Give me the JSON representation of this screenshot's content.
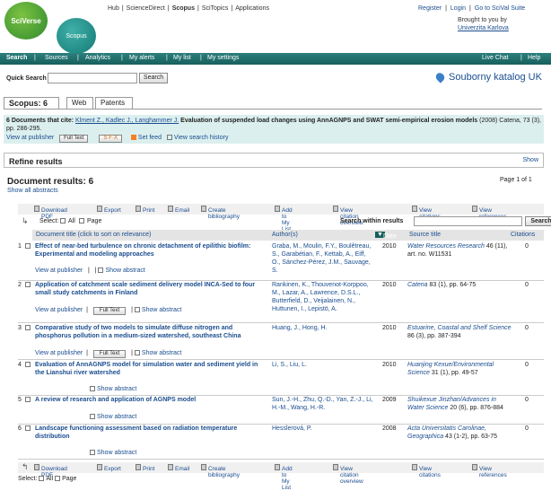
{
  "header": {
    "logo_main": "SciVerse",
    "logo_sub": "Scopus",
    "topnav": [
      "Hub",
      "|",
      "ScienceDirect",
      "|",
      "Scopus",
      "|",
      "SciTopics",
      "|",
      "Applications"
    ],
    "topright": [
      "Register",
      "|",
      "Login",
      "|",
      "Go to SciVal Suite"
    ],
    "brought_line1": "Brought to you by",
    "brought_line2": "Univerzita Karlova"
  },
  "mainbar": {
    "left": [
      "Search",
      "|",
      "Sources",
      "|",
      "Analytics",
      "|",
      "My alerts",
      "|",
      "My list",
      "|",
      "My settings"
    ],
    "live_chat": "Live Chat",
    "sep": "|",
    "help": "Help"
  },
  "quick_search": {
    "label": "Quick Search",
    "value": "",
    "button": "Search",
    "katalog": "Souborny katalog UK"
  },
  "tabs": [
    "Scopus: 6",
    "Web",
    "Patents"
  ],
  "cite": {
    "count_text": "6  Documents that cite:",
    "authors": "Klment Z., Kadlec J., Langhammer J.",
    "title": "Evaluation of suspended load changes using AnnAGNPS and SWAT semi-empirical erosion models",
    "source": "(2008) Catena, 73 (3), pp. 286-295.",
    "view_publisher": "View at publisher",
    "full_text": "Full Text",
    "sfx": "S·F·X",
    "rss": "Set feed",
    "history": "View search history"
  },
  "refine": {
    "title": "Refine results",
    "show": "Show"
  },
  "results": {
    "title": "Document results: 6",
    "show_abstracts": "Show all abstracts",
    "page_label": "Page",
    "page_info": "1 of 1"
  },
  "toolbar": [
    "Download PDF",
    "|",
    "Export",
    "|",
    "Print",
    "|",
    "Email",
    "|",
    "Create bibliography",
    "|",
    "Add to My List",
    "|",
    "View citation overview",
    "|",
    "View citations",
    "|",
    "View references"
  ],
  "select": {
    "label": "Select:",
    "all": "All",
    "page": "Page"
  },
  "search_within": {
    "label": "Search within results",
    "button": "Search",
    "value": ""
  },
  "table_headers": {
    "title": "Document title (click to sort on relevance)",
    "authors": "Author(s)",
    "date": "Date",
    "source": "Source title",
    "citations": "Citations"
  },
  "row_actions": {
    "view_publisher": "View at publisher",
    "full_text": "Full Text",
    "show_abstract": "Show abstract",
    "sep": "|"
  },
  "rows": [
    {
      "n": "1",
      "title": "Effect of near-bed turbulence on chronic detachment of epilithic biofilm: Experimental and modeling approaches",
      "authors": "Graba, M., Moulin, F.Y., Boulêtreau, S., Garabétian, F., Kettab, A., Eiff, O., Sánchez-Pérez, J.M., Sauvage, S.",
      "date": "2010",
      "source": "Water Resources Research",
      "source_rest": "46 (11), art. no. W11531",
      "cit": "0"
    },
    {
      "n": "2",
      "title": "Application of catchment scale sediment delivery model INCA-Sed to four small study catchments in Finland",
      "authors": "Rankinen, K., Thouvenot-Korppoo, M., Lazar, A., Lawrence, D.S.L., Butterfield, D., Veijalainen, N., Huttunen, I., Lepistö, A.",
      "date": "2010",
      "source": "Catena",
      "source_rest": "83 (1), pp. 64-75",
      "cit": "0"
    },
    {
      "n": "3",
      "title": "Comparative study of two models to simulate diffuse nitrogen and phosphorus pollution in a medium-sized watershed, southeast China",
      "authors": "Huang, J., Hong, H.",
      "date": "2010",
      "source": "Estuarine, Coastal and Shelf Science",
      "source_rest": "86 (3), pp. 387-394",
      "cit": "0"
    },
    {
      "n": "4",
      "title": "Evaluation of AnnAGNPS model for simulation water and sediment yield in the Lianshui river watershed",
      "authors": "Li, S., Liu, L.",
      "date": "2010",
      "source": "Huanjing Kexue/Environmental Science",
      "source_rest": "31 (1), pp. 49-57",
      "cit": "0"
    },
    {
      "n": "5",
      "title": "A review of research and application of AGNPS model",
      "authors": "Sun, J.-H., Zhu, Q.-D., Yan, Z.-J., Li, H.-M., Wang, H.-R.",
      "date": "2009",
      "source": "Shuikexue Jinzhan/Advances in Water Science",
      "source_rest": "20 (6), pp. 876-884",
      "cit": "0"
    },
    {
      "n": "6",
      "title": "Landscape functioning assessment based on radiation temperature distribution",
      "authors": "Hesslerová, P.",
      "date": "2008",
      "source": "Acta Universitatis Carolinae, Geographica",
      "source_rest": "43 (1-2), pp. 63-75",
      "cit": "0"
    }
  ]
}
